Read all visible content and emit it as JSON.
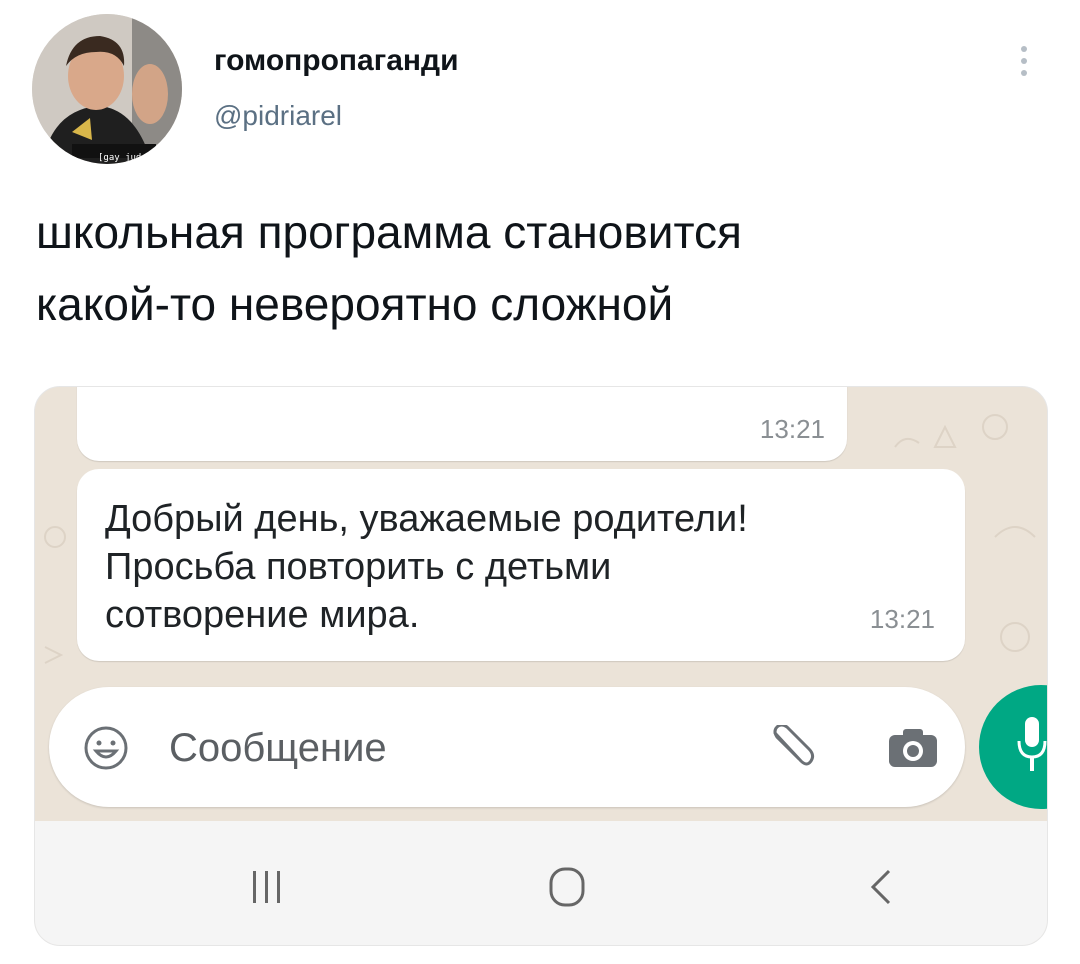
{
  "tweet": {
    "display_name": "гомопропаганди",
    "handle": "@pidriarel",
    "avatar_caption": "[gay judgement]",
    "text_lines": [
      "школьная программа становится",
      "какой-то невероятно сложной"
    ],
    "more_icon": "vertical-dots-icon"
  },
  "chat": {
    "previous_message_time": "13:21",
    "message": {
      "lines": [
        "Добрый день, уважаемые родители!",
        "Просьба повторить с детьми",
        "сотворение мира."
      ],
      "time": "13:21"
    },
    "composer": {
      "placeholder": "Сообщение",
      "emoji_icon": "emoji-icon",
      "attach_icon": "paperclip-icon",
      "camera_icon": "camera-icon"
    },
    "mic_icon": "microphone-icon",
    "accent_color": "#00a884"
  },
  "navbar": {
    "recents_icon": "recents-icon",
    "home_icon": "home-icon",
    "back_icon": "back-icon"
  }
}
